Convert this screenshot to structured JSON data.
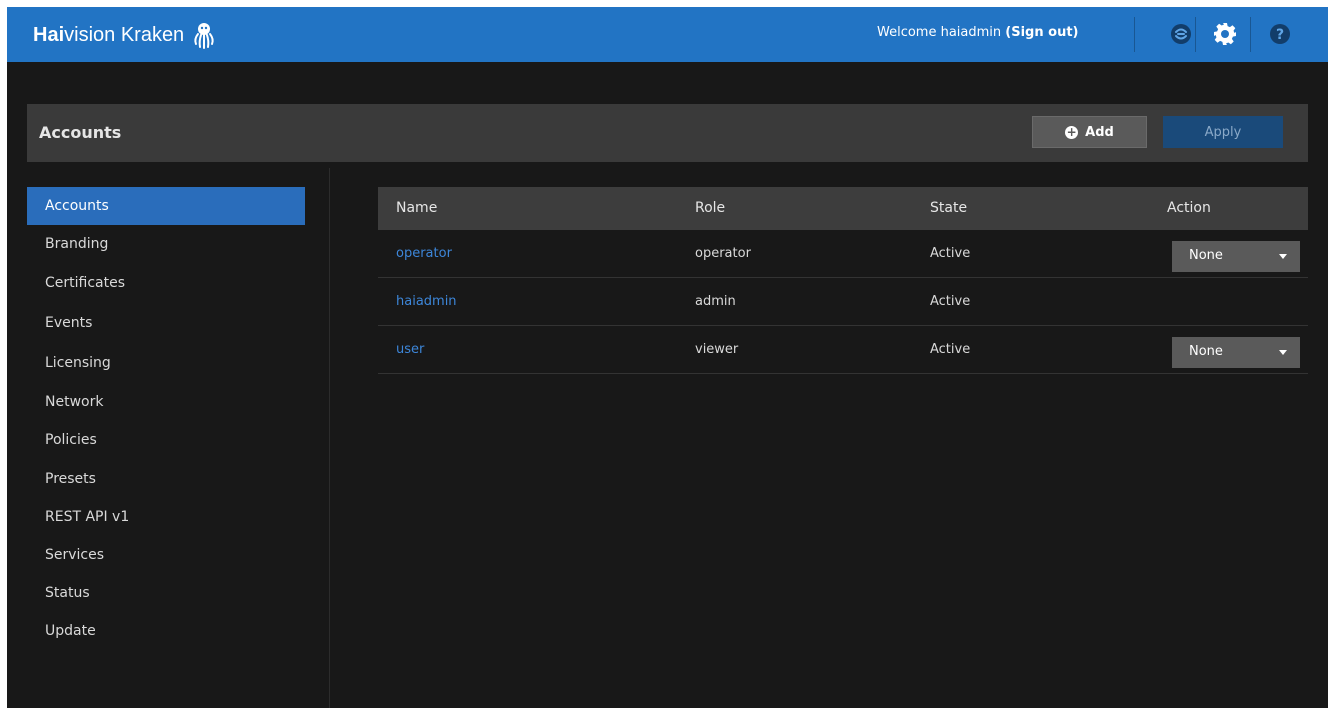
{
  "header": {
    "brand_bold": "Hai",
    "brand_rest": "vision Kraken",
    "welcome_text": "Welcome haiadmin",
    "signout_label": "(Sign out)",
    "icons": [
      "octopus-logo-icon",
      "network-icon",
      "gear-icon",
      "help-icon"
    ],
    "colors": {
      "bar": "#2274c4"
    }
  },
  "panel": {
    "title": "Accounts",
    "add_label": "Add",
    "apply_label": "Apply"
  },
  "sidebar": {
    "items": [
      {
        "label": "Accounts",
        "active": true
      },
      {
        "label": "Branding"
      },
      {
        "label": "Certificates"
      },
      {
        "label": "Events"
      },
      {
        "label": "Licensing"
      },
      {
        "label": "Network"
      },
      {
        "label": "Policies"
      },
      {
        "label": "Presets"
      },
      {
        "label": "REST API v1"
      },
      {
        "label": "Services"
      },
      {
        "label": "Status"
      },
      {
        "label": "Update"
      }
    ],
    "colors": {
      "active": "#2a6dbb"
    }
  },
  "table": {
    "columns": [
      "Name",
      "Role",
      "State",
      "Action"
    ],
    "rows": [
      {
        "name": "operator",
        "role": "operator",
        "state": "Active",
        "action": "None"
      },
      {
        "name": "haiadmin",
        "role": "admin",
        "state": "Active",
        "action": null
      },
      {
        "name": "user",
        "role": "viewer",
        "state": "Active",
        "action": "None"
      }
    ],
    "colors": {
      "link": "#3d86d9"
    }
  }
}
